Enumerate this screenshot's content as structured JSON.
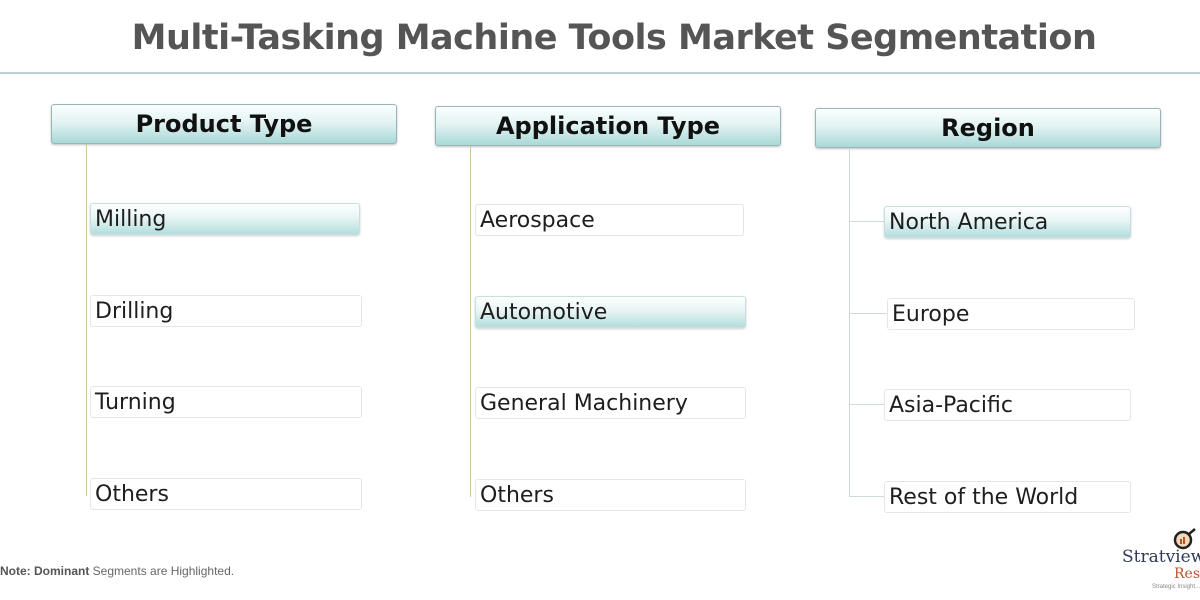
{
  "title": "Multi-Tasking Machine Tools Market Segmentation",
  "colors": {
    "header_gradient_bottom": "#a9d9d7",
    "highlight_gradient_bottom": "#b2dedc",
    "connector_left": "#c8ca9a",
    "connector_region": "#d0dada",
    "title_color": "#555555"
  },
  "columns": [
    {
      "header": "Product Type",
      "items": [
        {
          "label": "Milling",
          "highlighted": true
        },
        {
          "label": "Drilling",
          "highlighted": false
        },
        {
          "label": "Turning",
          "highlighted": false
        },
        {
          "label": "Others",
          "highlighted": false
        }
      ]
    },
    {
      "header": "Application Type",
      "items": [
        {
          "label": "Aerospace",
          "highlighted": false
        },
        {
          "label": "Automotive",
          "highlighted": true
        },
        {
          "label": "General Machinery",
          "highlighted": false
        },
        {
          "label": "Others",
          "highlighted": false
        }
      ]
    },
    {
      "header": "Region",
      "items": [
        {
          "label": "North America",
          "highlighted": true
        },
        {
          "label": "Europe",
          "highlighted": false
        },
        {
          "label": "Asia-Pacific",
          "highlighted": false
        },
        {
          "label": "Rest of the World",
          "highlighted": false
        }
      ]
    }
  ],
  "note": {
    "prefix": "Note: Dominant",
    "suffix": " Segments are Highlighted."
  },
  "logo": {
    "name": "Stratview",
    "sub": "Rese",
    "tagline": "Strategic Insight..."
  }
}
